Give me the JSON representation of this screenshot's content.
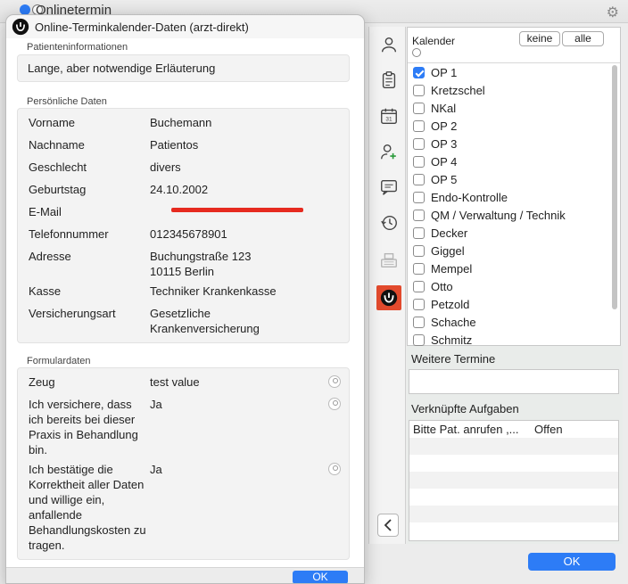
{
  "bg_window": {
    "title": "Onlinetermin"
  },
  "dialog": {
    "title": "Online-Terminkalender-Daten (arzt-direkt)",
    "sections": {
      "patient_info": {
        "label": "Patienteninformationen",
        "text": "Lange, aber notwendige Erläuterung"
      },
      "personal": {
        "label": "Persönliche Daten",
        "rows": [
          {
            "key": "Vorname",
            "value": "Buchemann"
          },
          {
            "key": "Nachname",
            "value": "Patientos"
          },
          {
            "key": "Geschlecht",
            "value": "divers"
          },
          {
            "key": "Geburtstag",
            "value": "24.10.2002"
          },
          {
            "key": "E-Mail",
            "value": ""
          },
          {
            "key": "Telefonnummer",
            "value": "012345678901"
          },
          {
            "key": "Adresse",
            "value": "Buchungstraße 123",
            "value2": "10115 Berlin"
          },
          {
            "key": "Kasse",
            "value": "Techniker Krankenkasse"
          },
          {
            "key": "Versicherungsart",
            "value": "Gesetzliche",
            "value2": "Krankenversicherung"
          }
        ]
      },
      "form": {
        "label": "Formulardaten",
        "rows": [
          {
            "key": "Zeug",
            "value": "test value"
          },
          {
            "key_lines": [
              "Ich versichere, dass",
              "ich bereits bei dieser",
              "Praxis in Behandlung",
              "bin."
            ],
            "value": "Ja"
          },
          {
            "key_lines": [
              "Ich bestätige die",
              "Korrektheit aller Daten",
              "und willige ein,",
              "anfallende",
              "Behandlungskosten zu",
              "tragen."
            ],
            "value": "Ja"
          }
        ]
      }
    },
    "ok_label": "OK"
  },
  "calendar": {
    "header_label": "Kalender",
    "btn_none": "keine",
    "btn_all": "alle",
    "items": [
      {
        "label": "OP 1",
        "checked": true
      },
      {
        "label": "Kretzschel",
        "checked": false
      },
      {
        "label": "NKal",
        "checked": false
      },
      {
        "label": "OP 2",
        "checked": false
      },
      {
        "label": "OP 3",
        "checked": false
      },
      {
        "label": "OP 4",
        "checked": false
      },
      {
        "label": "OP 5",
        "checked": false
      },
      {
        "label": "Endo-Kontrolle",
        "checked": false
      },
      {
        "label": "QM / Verwaltung / Technik",
        "checked": false
      },
      {
        "label": "Decker",
        "checked": false
      },
      {
        "label": "Giggel",
        "checked": false
      },
      {
        "label": "Mempel",
        "checked": false
      },
      {
        "label": "Otto",
        "checked": false
      },
      {
        "label": "Petzold",
        "checked": false
      },
      {
        "label": "Schache",
        "checked": false
      },
      {
        "label": "Schmitz",
        "checked": false
      }
    ]
  },
  "weitere_termine": {
    "label": "Weitere Termine"
  },
  "verknuepfte_aufgaben": {
    "label": "Verknüpfte Aufgaben",
    "rows": [
      {
        "task": "Bitte Pat. anrufen ,...",
        "status": "Offen"
      }
    ]
  },
  "main_ok_label": "OK",
  "colors": {
    "accent": "#2d7cf6",
    "active_tool": "#e24a2d",
    "redaction": "#e62a1f"
  }
}
